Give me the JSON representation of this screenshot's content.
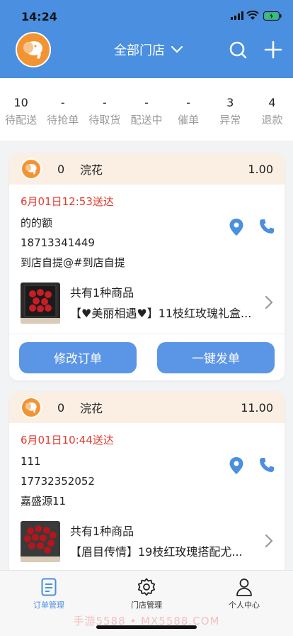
{
  "status": {
    "time": "14:24"
  },
  "header": {
    "store_select": "全部门店"
  },
  "stats": [
    {
      "num": "10",
      "label": "待配送"
    },
    {
      "num": "-",
      "label": "待抢单"
    },
    {
      "num": "-",
      "label": "待取货"
    },
    {
      "num": "-",
      "label": "配送中"
    },
    {
      "num": "-",
      "label": "催单"
    },
    {
      "num": "3",
      "label": "异常"
    },
    {
      "num": "4",
      "label": "退款"
    }
  ],
  "orders": [
    {
      "index": "0",
      "shop": "浣花",
      "amount": "1.00",
      "due": "6月01日12:53送达",
      "customer": "的的额",
      "phone": "18713341449",
      "address": "到店自提@#到店自提",
      "goods_count": "共有1种商品",
      "goods_name": "【♥美丽相遇♥】11枝红玫瑰礼盒...",
      "btn_edit": "修改订单",
      "btn_send": "一键发单"
    },
    {
      "index": "0",
      "shop": "浣花",
      "amount": "11.00",
      "due": "6月01日10:44送达",
      "customer": "111",
      "phone": "17732352052",
      "address": "嘉盛源11",
      "goods_count": "共有1种商品",
      "goods_name": "【眉目传情】19枝红玫瑰搭配尤..."
    }
  ],
  "tabbar": [
    {
      "label": "订单管理",
      "icon": "order-doc-icon"
    },
    {
      "label": "门店管理",
      "icon": "gear-icon"
    },
    {
      "label": "个人中心",
      "icon": "user-icon"
    }
  ],
  "watermark": "手游5588 • MX5588.COM",
  "colors": {
    "primary": "#4a8fe0",
    "button": "#5b95e6",
    "accent_orange": "#f39433",
    "due_red": "#e23b2e",
    "card_head": "#fbefe3"
  }
}
